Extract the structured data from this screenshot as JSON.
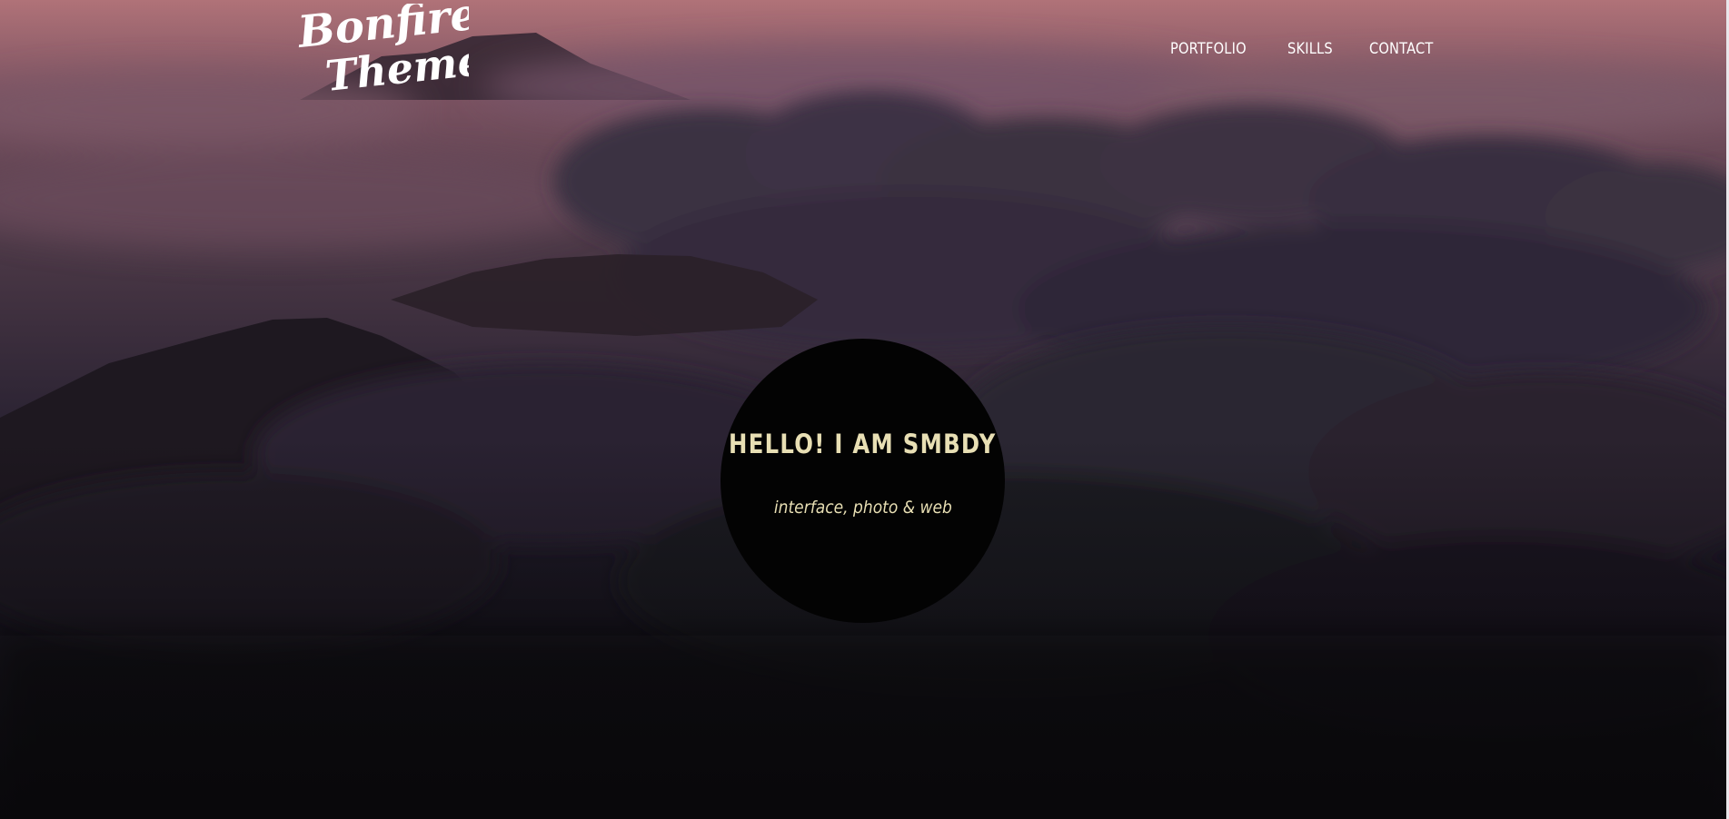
{
  "header": {
    "logo_line1": "Bonfire",
    "logo_line2": "Themes"
  },
  "nav": {
    "items": [
      {
        "label": "PORTFOLIO"
      },
      {
        "label": "SKILLS"
      },
      {
        "label": "CONTACT"
      }
    ]
  },
  "intro": {
    "title": "HELLO! I AM SMBDY",
    "subtitle": "interface, photo & web"
  },
  "colors": {
    "intro_text": "#e8dfb4",
    "circle_bg": "#030303",
    "nav_text": "#ffffff"
  }
}
